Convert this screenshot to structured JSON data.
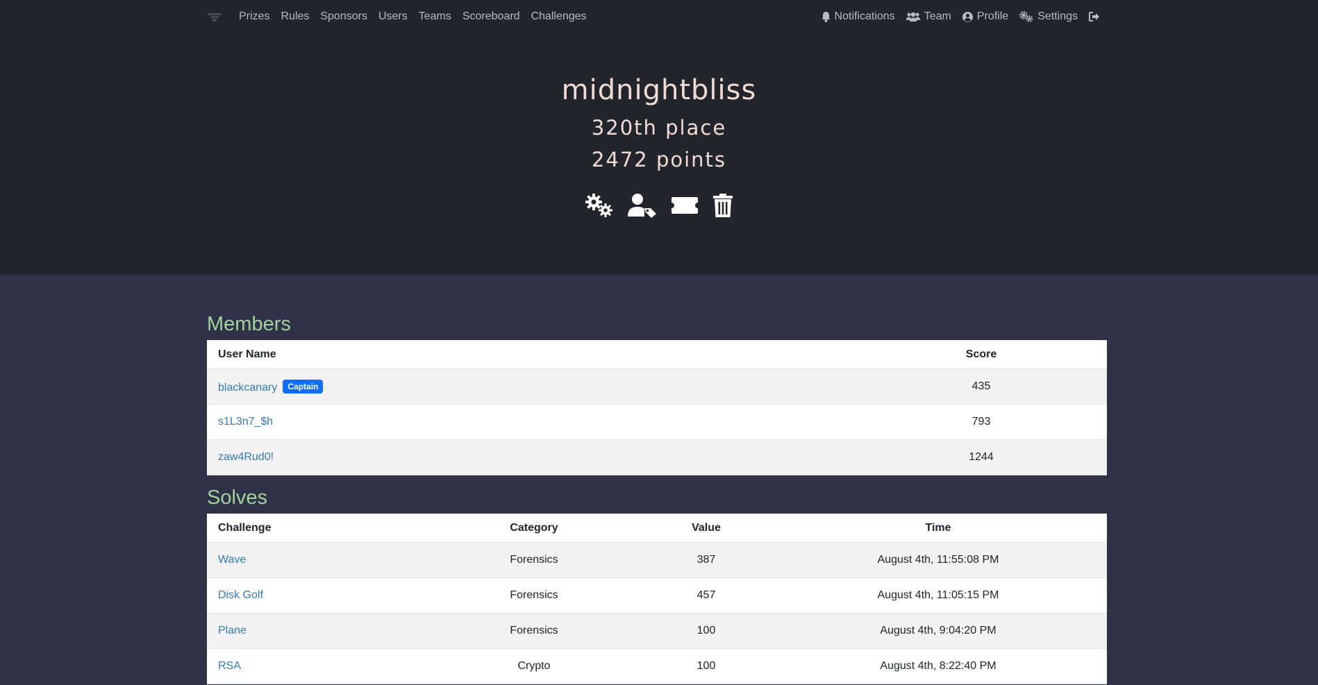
{
  "nav": {
    "left_links": [
      "Prizes",
      "Rules",
      "Sponsors",
      "Users",
      "Teams",
      "Scoreboard",
      "Challenges"
    ],
    "notifications": "Notifications",
    "team": "Team",
    "profile": "Profile",
    "settings": "Settings"
  },
  "team": {
    "name": "midnightbliss",
    "place": "320th place",
    "points": "2472 points"
  },
  "members": {
    "title": "Members",
    "headers": {
      "user_name": "User Name",
      "score": "Score"
    },
    "rows": [
      {
        "name": "blackcanary",
        "badge": "Captain",
        "score": "435"
      },
      {
        "name": "s1L3n7_$h",
        "score": "793"
      },
      {
        "name": "zaw4Rud0!",
        "score": "1244"
      }
    ]
  },
  "solves": {
    "title": "Solves",
    "headers": {
      "challenge": "Challenge",
      "category": "Category",
      "value": "Value",
      "time": "Time"
    },
    "rows": [
      {
        "challenge": "Wave",
        "category": "Forensics",
        "value": "387",
        "time": "August 4th, 11:55:08 PM"
      },
      {
        "challenge": "Disk Golf",
        "category": "Forensics",
        "value": "457",
        "time": "August 4th, 11:05:15 PM"
      },
      {
        "challenge": "Plane",
        "category": "Forensics",
        "value": "100",
        "time": "August 4th, 9:04:20 PM"
      },
      {
        "challenge": "RSA",
        "category": "Crypto",
        "value": "100",
        "time": "August 4th, 8:22:40 PM"
      }
    ]
  },
  "colors": {
    "header_bg": "#22252c",
    "page_bg": "#303348",
    "section_title": "#a3d39c",
    "link": "#337ab7",
    "badge": "#0d6efd",
    "jumbo_text": "#f2dcd5"
  },
  "icons": {
    "action_buttons": [
      "gears-icon",
      "user-tag-icon",
      "ticket-icon",
      "trash-icon"
    ]
  }
}
